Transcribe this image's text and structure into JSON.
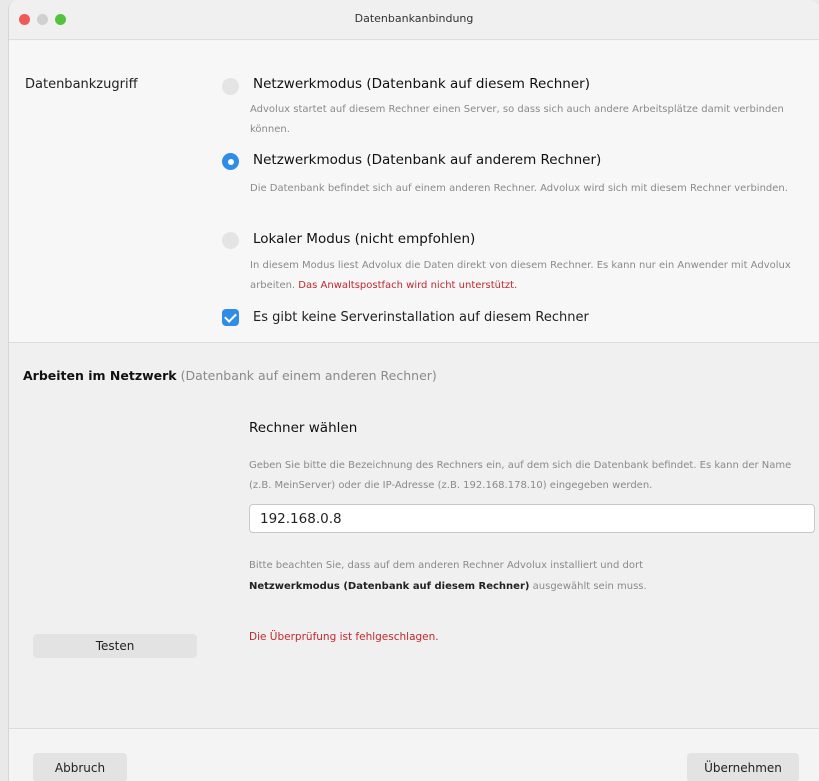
{
  "window": {
    "title": "Datenbankanbindung"
  },
  "access": {
    "label": "Datenbankzugriff",
    "options": [
      {
        "title": "Netzwerkmodus (Datenbank auf diesem Rechner)",
        "description": "Advolux startet auf diesem Rechner einen Server, so dass sich auch andere Arbeitsplätze damit verbinden können.",
        "selected": false
      },
      {
        "title": "Netzwerkmodus (Datenbank auf anderem Rechner)",
        "description": "Die Datenbank befindet sich auf einem anderen Rechner. Advolux wird sich mit diesem Rechner verbinden.",
        "selected": true
      },
      {
        "title": "Lokaler Modus (nicht empfohlen)",
        "description": "In diesem Modus liest Advolux die Daten direkt von diesem Rechner. Es kann nur ein Anwender mit Advolux arbeiten.",
        "warning": "Das Anwaltspostfach wird nicht unterstützt.",
        "selected": false
      }
    ],
    "checkbox": {
      "label": "Es gibt keine Serverinstallation auf diesem Rechner",
      "checked": true
    }
  },
  "network": {
    "heading_bold": "Arbeiten im Netzwerk",
    "heading_sub": "(Datenbank auf einem anderen Rechner)",
    "choose_title": "Rechner wählen",
    "choose_description": "Geben Sie bitte die Bezeichnung des Rechners ein, auf dem sich die Datenbank befindet. Es kann der Name (z.B. MeinServer) oder die IP-Adresse (z.B. 192.168.178.10) eingegeben werden.",
    "host_value": "192.168.0.8",
    "note_prefix": "Bitte beachten Sie, dass auf dem anderen Rechner Advolux installiert und dort",
    "note_bold": "Netzwerkmodus (Datenbank auf diesem Rechner)",
    "note_suffix": "ausgewählt sein muss.",
    "test_label": "Testen",
    "status_message": "Die Überprüfung ist fehlgeschlagen."
  },
  "footer": {
    "cancel_label": "Abbruch",
    "apply_label": "Übernehmen"
  },
  "colors": {
    "accent": "#2f8de8",
    "error": "#c2272d"
  }
}
